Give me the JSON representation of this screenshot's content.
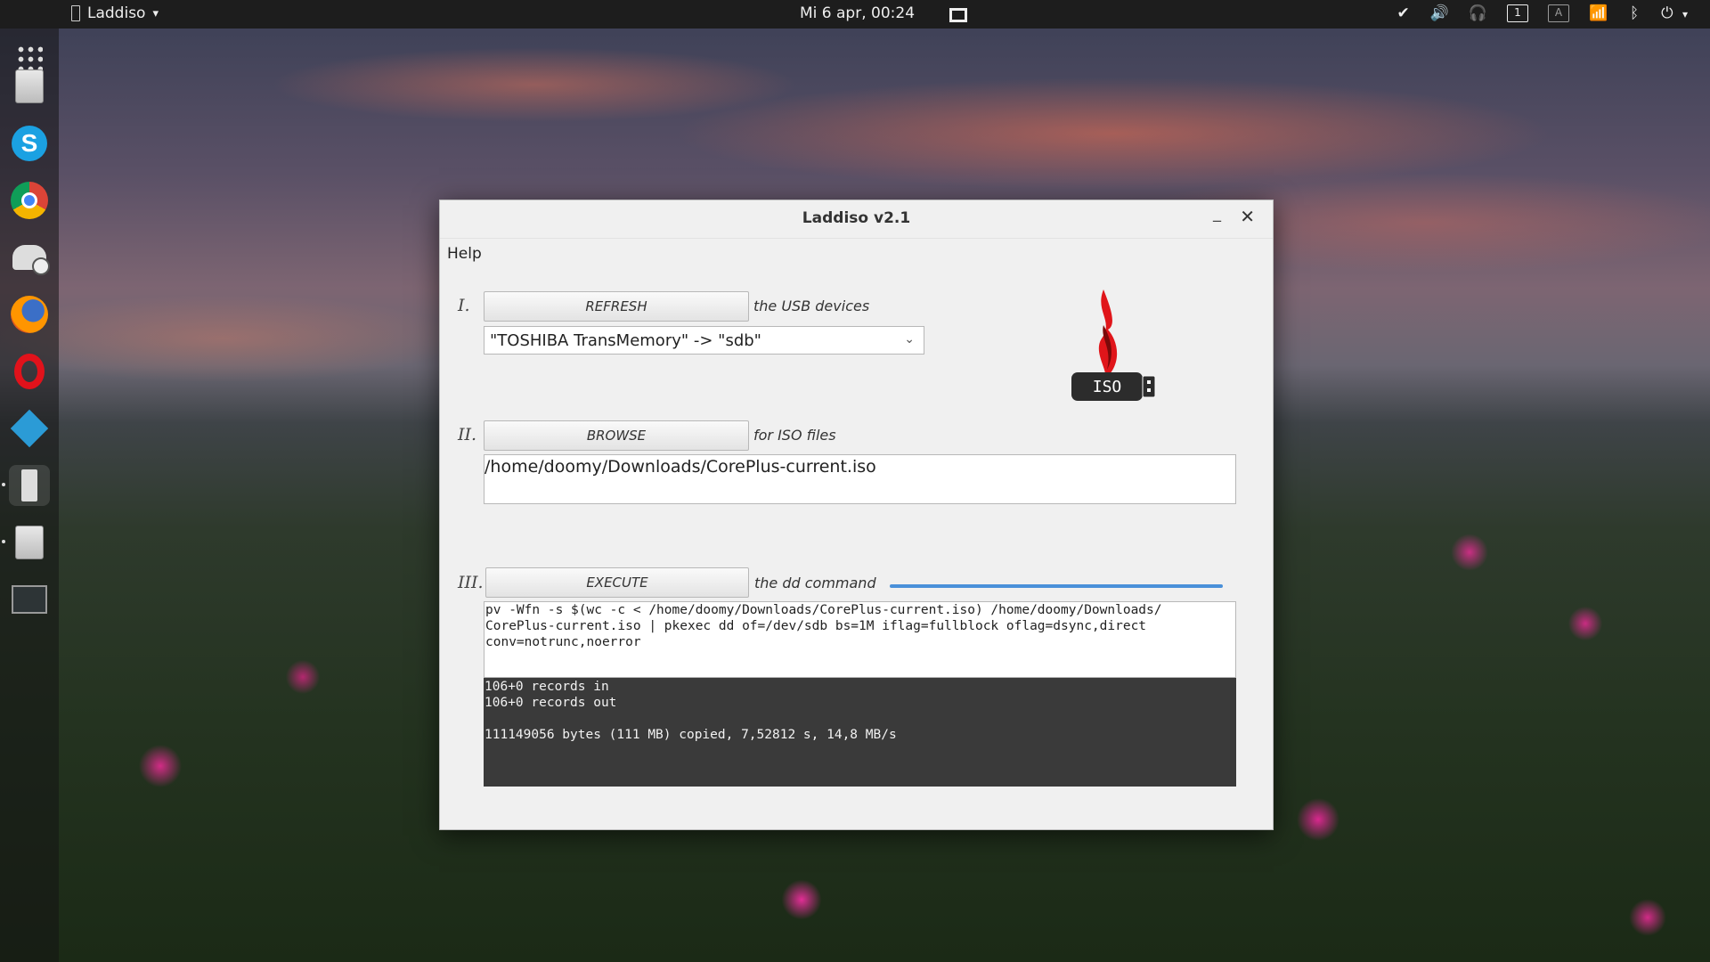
{
  "topbar": {
    "app_name": "Laddiso",
    "app_menu_arrow": "▾",
    "clock": "Mi  6 apr, 00:24",
    "tray": {
      "workspace": "1",
      "input": "A",
      "power_arrow": "▾"
    }
  },
  "dock": {
    "items": [
      "files",
      "skype",
      "chrome",
      "backup",
      "firefox",
      "opera",
      "kodi",
      "usb-writer",
      "files-2",
      "terminal"
    ]
  },
  "window": {
    "title": "Laddiso v2.1",
    "menu": {
      "help": "Help"
    },
    "step1": {
      "numeral": "I.",
      "button": "REFRESH",
      "hint": "the USB devices",
      "device_selected": "\"TOSHIBA TransMemory\" -> \"sdb\""
    },
    "step2": {
      "numeral": "II.",
      "button": "BROWSE",
      "hint": "for ISO files",
      "path": "/home/doomy/Downloads/CorePlus-current.iso"
    },
    "step3": {
      "numeral": "III.",
      "button": "EXECUTE",
      "hint": "the dd command",
      "progress": 1.0,
      "command": "pv -Wfn -s $(wc -c < /home/doomy/Downloads/CorePlus-current.iso) /home/doomy/Downloads/\nCorePlus-current.iso | pkexec dd of=/dev/sdb bs=1M iflag=fullblock oflag=dsync,direct\nconv=notrunc,noerror",
      "output": "106+0 records in\n106+0 records out\n\n111149056 bytes (111 MB) copied, 7,52812 s, 14,8 MB/s"
    },
    "logo_text": "ISO",
    "accent_color": "#4a90d9"
  }
}
